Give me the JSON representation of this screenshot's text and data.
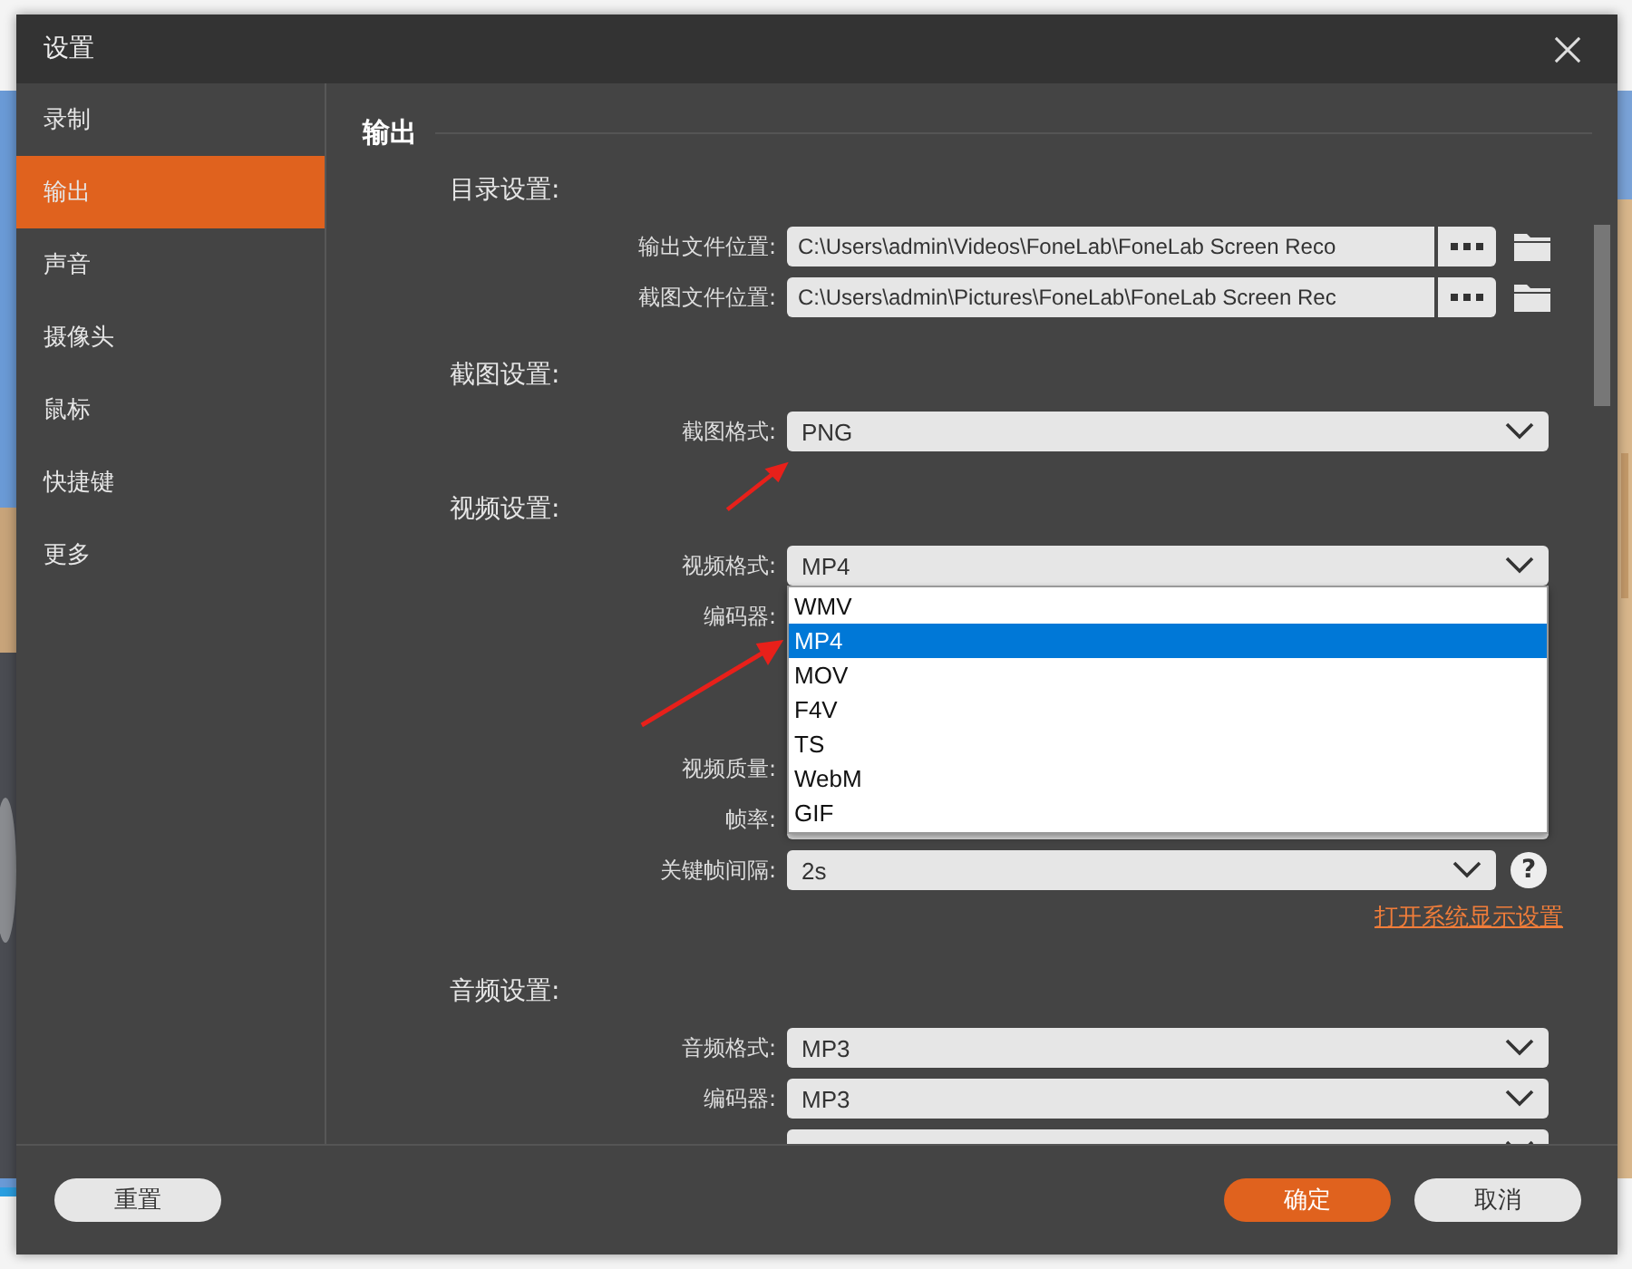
{
  "window": {
    "title": "设置"
  },
  "sidebar": {
    "items": [
      {
        "label": "录制",
        "selected": false
      },
      {
        "label": "输出",
        "selected": true
      },
      {
        "label": "声音",
        "selected": false
      },
      {
        "label": "摄像头",
        "selected": false
      },
      {
        "label": "鼠标",
        "selected": false
      },
      {
        "label": "快捷键",
        "selected": false
      },
      {
        "label": "更多",
        "selected": false
      }
    ]
  },
  "content": {
    "heading": "输出",
    "sections": [
      {
        "title": "目录设置:",
        "rows": [
          {
            "kind": "path",
            "label": "输出文件位置:",
            "value": "C:\\Users\\admin\\Videos\\FoneLab\\FoneLab Screen Reco"
          },
          {
            "kind": "path",
            "label": "截图文件位置:",
            "value": "C:\\Users\\admin\\Pictures\\FoneLab\\FoneLab Screen Rec"
          }
        ]
      },
      {
        "title": "截图设置:",
        "rows": [
          {
            "kind": "select",
            "label": "截图格式:",
            "value": "PNG"
          }
        ]
      },
      {
        "title": "视频设置:",
        "rows": [
          {
            "kind": "select",
            "label": "视频格式:",
            "value": "MP4",
            "expanded": true,
            "options": [
              {
                "label": "WMV",
                "selected": false
              },
              {
                "label": "MP4",
                "selected": true
              },
              {
                "label": "MOV",
                "selected": false
              },
              {
                "label": "F4V",
                "selected": false
              },
              {
                "label": "TS",
                "selected": false
              },
              {
                "label": "WebM",
                "selected": false
              },
              {
                "label": "GIF",
                "selected": false
              }
            ]
          },
          {
            "kind": "covered",
            "label": "编码器:"
          },
          {
            "kind": "covered"
          },
          {
            "kind": "covered"
          },
          {
            "kind": "covered",
            "label": "视频质量:"
          },
          {
            "kind": "select-under-menu",
            "label": "帧率:"
          },
          {
            "kind": "select",
            "label": "关键帧间隔:",
            "value": "2s",
            "help": "?"
          },
          {
            "kind": "link",
            "label": "打开系统显示设置"
          }
        ]
      },
      {
        "title": "音频设置:",
        "rows": [
          {
            "kind": "select",
            "label": "音频格式:",
            "value": "MP3"
          },
          {
            "kind": "select",
            "label": "编码器:",
            "value": "MP3"
          },
          {
            "kind": "select"
          }
        ]
      }
    ]
  },
  "footer": {
    "reset": "重置",
    "ok": "确定",
    "cancel": "取消"
  }
}
